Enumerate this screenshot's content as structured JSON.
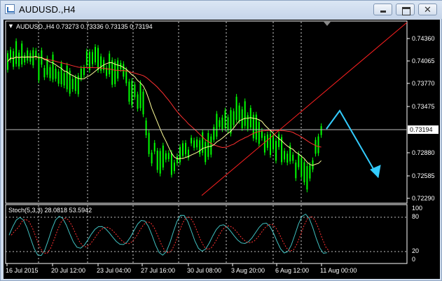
{
  "window": {
    "title": "AUDUSD.,H4",
    "buttons": {
      "minimize": "minimize",
      "maximize": "maximize",
      "close": "✕"
    }
  },
  "chart": {
    "header": "AUDUSD.,H4  0.73273 0.73336 0.73135 0.73194",
    "current_price": "0.73194",
    "price_axis": [
      "0.74360",
      "0.74065",
      "0.73770",
      "0.73475",
      "0.73194",
      "0.72880",
      "0.72585",
      "0.72290"
    ],
    "time_axis": [
      "16 Jul 2015",
      "20 Jul 12:00",
      "23 Jul 04:00",
      "27 Jul 16:00",
      "30 Jul 08:00",
      "3 Aug 20:00",
      "6 Aug 12:00",
      "11 Aug 00:00"
    ],
    "colors": {
      "background": "#000000",
      "candles": "#00ff00",
      "ma_fast": "#ffff99",
      "ma_slow": "#ff3030",
      "trendline": "#ff2020",
      "projection_arrow": "#33ccff",
      "stoch_main": "#40c0c0",
      "stoch_signal": "#ff3030",
      "price_line": "#c0c0c0"
    }
  },
  "stochastic": {
    "header": "Stoch(5,3,3) 28.0818 53.5942",
    "scale": [
      "100",
      "80",
      "20",
      "0"
    ]
  }
}
